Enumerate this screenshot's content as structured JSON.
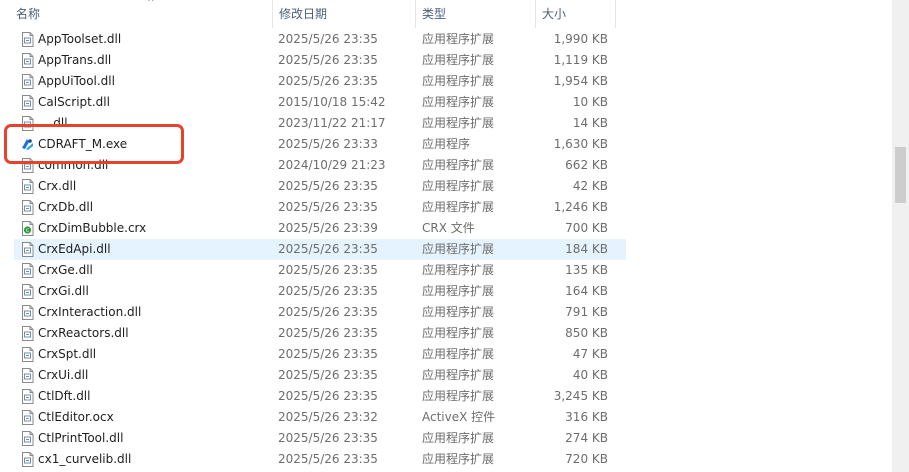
{
  "columns": {
    "name": "名称",
    "date": "修改日期",
    "type": "类型",
    "size": "大小"
  },
  "sort_indicator": "^",
  "files": [
    {
      "name": "AppToolset.dll",
      "date": "2025/5/26 23:35",
      "type": "应用程序扩展",
      "size": "1,990 KB",
      "icon": "dll-file-icon"
    },
    {
      "name": "AppTrans.dll",
      "date": "2025/5/26 23:35",
      "type": "应用程序扩展",
      "size": "1,119 KB",
      "icon": "dll-file-icon"
    },
    {
      "name": "AppUiTool.dll",
      "date": "2025/5/26 23:35",
      "type": "应用程序扩展",
      "size": "1,954 KB",
      "icon": "dll-file-icon"
    },
    {
      "name": "CalScript.dll",
      "date": "2015/10/18 15:42",
      "type": "应用程序扩展",
      "size": "10 KB",
      "icon": "dll-file-icon"
    },
    {
      "name": "....dll",
      "date": "2023/11/22 21:17",
      "type": "应用程序扩展",
      "size": "14 KB",
      "icon": "dll-file-icon"
    },
    {
      "name": "CDRAFT_M.exe",
      "date": "2025/5/26 23:33",
      "type": "应用程序",
      "size": "1,630 KB",
      "icon": "cdraft-app-icon"
    },
    {
      "name": "common.dll",
      "date": "2024/10/29 21:23",
      "type": "应用程序扩展",
      "size": "662 KB",
      "icon": "dll-file-icon"
    },
    {
      "name": "Crx.dll",
      "date": "2025/5/26 23:35",
      "type": "应用程序扩展",
      "size": "42 KB",
      "icon": "dll-file-icon"
    },
    {
      "name": "CrxDb.dll",
      "date": "2025/5/26 23:35",
      "type": "应用程序扩展",
      "size": "1,246 KB",
      "icon": "dll-file-icon"
    },
    {
      "name": "CrxDimBubble.crx",
      "date": "2025/5/26 23:39",
      "type": "CRX 文件",
      "size": "700 KB",
      "icon": "crx-file-icon"
    },
    {
      "name": "CrxEdApi.dll",
      "date": "2025/5/26 23:35",
      "type": "应用程序扩展",
      "size": "184 KB",
      "icon": "dll-file-icon"
    },
    {
      "name": "CrxGe.dll",
      "date": "2025/5/26 23:35",
      "type": "应用程序扩展",
      "size": "135 KB",
      "icon": "dll-file-icon"
    },
    {
      "name": "CrxGi.dll",
      "date": "2025/5/26 23:35",
      "type": "应用程序扩展",
      "size": "164 KB",
      "icon": "dll-file-icon"
    },
    {
      "name": "CrxInteraction.dll",
      "date": "2025/5/26 23:35",
      "type": "应用程序扩展",
      "size": "791 KB",
      "icon": "dll-file-icon"
    },
    {
      "name": "CrxReactors.dll",
      "date": "2025/5/26 23:35",
      "type": "应用程序扩展",
      "size": "850 KB",
      "icon": "dll-file-icon"
    },
    {
      "name": "CrxSpt.dll",
      "date": "2025/5/26 23:35",
      "type": "应用程序扩展",
      "size": "47 KB",
      "icon": "dll-file-icon"
    },
    {
      "name": "CrxUi.dll",
      "date": "2025/5/26 23:35",
      "type": "应用程序扩展",
      "size": "40 KB",
      "icon": "dll-file-icon"
    },
    {
      "name": "CtlDft.dll",
      "date": "2025/5/26 23:35",
      "type": "应用程序扩展",
      "size": "3,245 KB",
      "icon": "dll-file-icon"
    },
    {
      "name": "CtlEditor.ocx",
      "date": "2025/5/26 23:32",
      "type": "ActiveX 控件",
      "size": "316 KB",
      "icon": "ocx-file-icon"
    },
    {
      "name": "CtlPrintTool.dll",
      "date": "2025/5/26 23:35",
      "type": "应用程序扩展",
      "size": "274 KB",
      "icon": "dll-file-icon"
    },
    {
      "name": "cx1_curvelib.dll",
      "date": "2025/5/26 23:35",
      "type": "应用程序扩展",
      "size": "720 KB",
      "icon": "dll-file-icon"
    }
  ],
  "hovered_row_index": 10,
  "highlighted_row_index": 5,
  "colors": {
    "hover": "#e5f3ff",
    "annotation": "#e8412c",
    "header_text": "#4c607a"
  }
}
